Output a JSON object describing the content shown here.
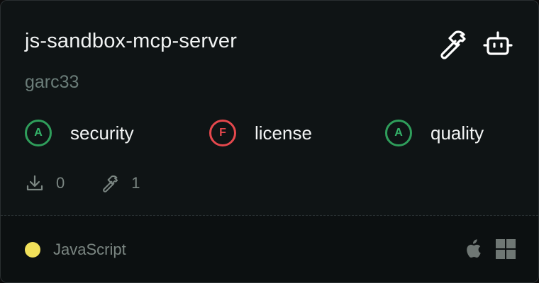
{
  "card": {
    "title": "js-sandbox-mcp-server",
    "author": "garc33",
    "header_icons": [
      "hammer-icon",
      "bot-icon"
    ],
    "scores": [
      {
        "grade": "A",
        "label": "security",
        "status": "good"
      },
      {
        "grade": "F",
        "label": "license",
        "status": "bad"
      },
      {
        "grade": "A",
        "label": "quality",
        "status": "good"
      }
    ],
    "stats": {
      "downloads": "0",
      "tools": "1"
    },
    "footer": {
      "language": "JavaScript",
      "language_color": "#f1e05a",
      "platforms": [
        "apple-icon",
        "windows-icon"
      ]
    }
  },
  "colors": {
    "good": "#2f9e5b",
    "bad": "#e5484d",
    "text": "#f2f4f4",
    "muted": "#6b7d79"
  }
}
